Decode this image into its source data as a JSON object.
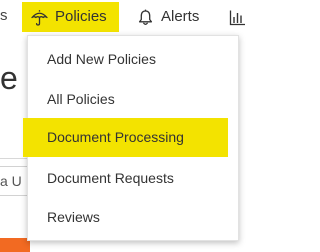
{
  "nav": {
    "partial_left_text": "s",
    "tabs": [
      {
        "label": "Policies",
        "icon": "umbrella-icon",
        "active": true
      },
      {
        "label": "Alerts",
        "icon": "bell-icon",
        "active": false
      },
      {
        "label": "",
        "icon": "bar-chart-icon",
        "active": false
      }
    ]
  },
  "background": {
    "heading_fragment": "e",
    "input_fragment": "a U"
  },
  "menu": {
    "items": [
      {
        "label": "Add New Policies"
      },
      {
        "label": "All Policies"
      },
      {
        "label": "Document Processing",
        "highlighted": true
      },
      {
        "label": "Document Requests"
      },
      {
        "label": "Reviews"
      }
    ]
  },
  "colors": {
    "highlight": "#f3e300",
    "accent_orange": "#f26a22",
    "text": "#333333"
  }
}
